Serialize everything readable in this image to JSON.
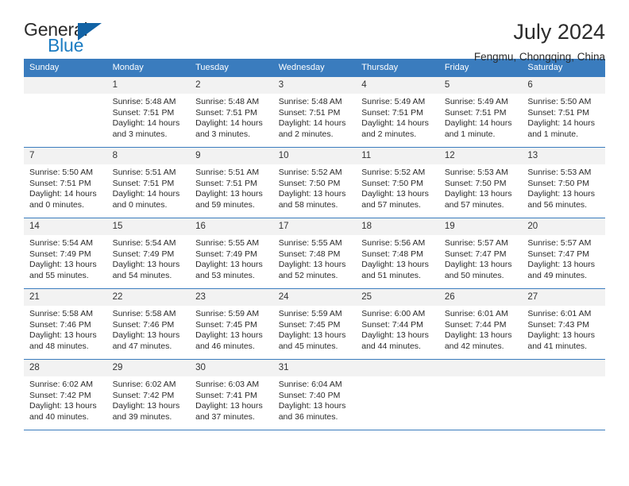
{
  "brand": {
    "name_top": "General",
    "name_bottom": "Blue",
    "triangle_icon": "blue-triangle-logo-mark",
    "color_top": "#2b2b2b",
    "color_bottom": "#1b7cc2",
    "accent": "#1263a5"
  },
  "header": {
    "title": "July 2024",
    "subtitle": "Fengmu, Chongqing, China"
  },
  "theme": {
    "header_bg": "#3a7cbe",
    "header_text": "#ffffff",
    "daynum_bg": "#f2f2f2",
    "grid_line": "#3a7cbe"
  },
  "weekdays": [
    "Sunday",
    "Monday",
    "Tuesday",
    "Wednesday",
    "Thursday",
    "Friday",
    "Saturday"
  ],
  "weeks": [
    [
      {
        "day": "",
        "sunrise": "",
        "sunset": "",
        "daylight_line1": "",
        "daylight_line2": ""
      },
      {
        "day": "1",
        "sunrise": "Sunrise: 5:48 AM",
        "sunset": "Sunset: 7:51 PM",
        "daylight_line1": "Daylight: 14 hours",
        "daylight_line2": "and 3 minutes."
      },
      {
        "day": "2",
        "sunrise": "Sunrise: 5:48 AM",
        "sunset": "Sunset: 7:51 PM",
        "daylight_line1": "Daylight: 14 hours",
        "daylight_line2": "and 3 minutes."
      },
      {
        "day": "3",
        "sunrise": "Sunrise: 5:48 AM",
        "sunset": "Sunset: 7:51 PM",
        "daylight_line1": "Daylight: 14 hours",
        "daylight_line2": "and 2 minutes."
      },
      {
        "day": "4",
        "sunrise": "Sunrise: 5:49 AM",
        "sunset": "Sunset: 7:51 PM",
        "daylight_line1": "Daylight: 14 hours",
        "daylight_line2": "and 2 minutes."
      },
      {
        "day": "5",
        "sunrise": "Sunrise: 5:49 AM",
        "sunset": "Sunset: 7:51 PM",
        "daylight_line1": "Daylight: 14 hours",
        "daylight_line2": "and 1 minute."
      },
      {
        "day": "6",
        "sunrise": "Sunrise: 5:50 AM",
        "sunset": "Sunset: 7:51 PM",
        "daylight_line1": "Daylight: 14 hours",
        "daylight_line2": "and 1 minute."
      }
    ],
    [
      {
        "day": "7",
        "sunrise": "Sunrise: 5:50 AM",
        "sunset": "Sunset: 7:51 PM",
        "daylight_line1": "Daylight: 14 hours",
        "daylight_line2": "and 0 minutes."
      },
      {
        "day": "8",
        "sunrise": "Sunrise: 5:51 AM",
        "sunset": "Sunset: 7:51 PM",
        "daylight_line1": "Daylight: 14 hours",
        "daylight_line2": "and 0 minutes."
      },
      {
        "day": "9",
        "sunrise": "Sunrise: 5:51 AM",
        "sunset": "Sunset: 7:51 PM",
        "daylight_line1": "Daylight: 13 hours",
        "daylight_line2": "and 59 minutes."
      },
      {
        "day": "10",
        "sunrise": "Sunrise: 5:52 AM",
        "sunset": "Sunset: 7:50 PM",
        "daylight_line1": "Daylight: 13 hours",
        "daylight_line2": "and 58 minutes."
      },
      {
        "day": "11",
        "sunrise": "Sunrise: 5:52 AM",
        "sunset": "Sunset: 7:50 PM",
        "daylight_line1": "Daylight: 13 hours",
        "daylight_line2": "and 57 minutes."
      },
      {
        "day": "12",
        "sunrise": "Sunrise: 5:53 AM",
        "sunset": "Sunset: 7:50 PM",
        "daylight_line1": "Daylight: 13 hours",
        "daylight_line2": "and 57 minutes."
      },
      {
        "day": "13",
        "sunrise": "Sunrise: 5:53 AM",
        "sunset": "Sunset: 7:50 PM",
        "daylight_line1": "Daylight: 13 hours",
        "daylight_line2": "and 56 minutes."
      }
    ],
    [
      {
        "day": "14",
        "sunrise": "Sunrise: 5:54 AM",
        "sunset": "Sunset: 7:49 PM",
        "daylight_line1": "Daylight: 13 hours",
        "daylight_line2": "and 55 minutes."
      },
      {
        "day": "15",
        "sunrise": "Sunrise: 5:54 AM",
        "sunset": "Sunset: 7:49 PM",
        "daylight_line1": "Daylight: 13 hours",
        "daylight_line2": "and 54 minutes."
      },
      {
        "day": "16",
        "sunrise": "Sunrise: 5:55 AM",
        "sunset": "Sunset: 7:49 PM",
        "daylight_line1": "Daylight: 13 hours",
        "daylight_line2": "and 53 minutes."
      },
      {
        "day": "17",
        "sunrise": "Sunrise: 5:55 AM",
        "sunset": "Sunset: 7:48 PM",
        "daylight_line1": "Daylight: 13 hours",
        "daylight_line2": "and 52 minutes."
      },
      {
        "day": "18",
        "sunrise": "Sunrise: 5:56 AM",
        "sunset": "Sunset: 7:48 PM",
        "daylight_line1": "Daylight: 13 hours",
        "daylight_line2": "and 51 minutes."
      },
      {
        "day": "19",
        "sunrise": "Sunrise: 5:57 AM",
        "sunset": "Sunset: 7:47 PM",
        "daylight_line1": "Daylight: 13 hours",
        "daylight_line2": "and 50 minutes."
      },
      {
        "day": "20",
        "sunrise": "Sunrise: 5:57 AM",
        "sunset": "Sunset: 7:47 PM",
        "daylight_line1": "Daylight: 13 hours",
        "daylight_line2": "and 49 minutes."
      }
    ],
    [
      {
        "day": "21",
        "sunrise": "Sunrise: 5:58 AM",
        "sunset": "Sunset: 7:46 PM",
        "daylight_line1": "Daylight: 13 hours",
        "daylight_line2": "and 48 minutes."
      },
      {
        "day": "22",
        "sunrise": "Sunrise: 5:58 AM",
        "sunset": "Sunset: 7:46 PM",
        "daylight_line1": "Daylight: 13 hours",
        "daylight_line2": "and 47 minutes."
      },
      {
        "day": "23",
        "sunrise": "Sunrise: 5:59 AM",
        "sunset": "Sunset: 7:45 PM",
        "daylight_line1": "Daylight: 13 hours",
        "daylight_line2": "and 46 minutes."
      },
      {
        "day": "24",
        "sunrise": "Sunrise: 5:59 AM",
        "sunset": "Sunset: 7:45 PM",
        "daylight_line1": "Daylight: 13 hours",
        "daylight_line2": "and 45 minutes."
      },
      {
        "day": "25",
        "sunrise": "Sunrise: 6:00 AM",
        "sunset": "Sunset: 7:44 PM",
        "daylight_line1": "Daylight: 13 hours",
        "daylight_line2": "and 44 minutes."
      },
      {
        "day": "26",
        "sunrise": "Sunrise: 6:01 AM",
        "sunset": "Sunset: 7:44 PM",
        "daylight_line1": "Daylight: 13 hours",
        "daylight_line2": "and 42 minutes."
      },
      {
        "day": "27",
        "sunrise": "Sunrise: 6:01 AM",
        "sunset": "Sunset: 7:43 PM",
        "daylight_line1": "Daylight: 13 hours",
        "daylight_line2": "and 41 minutes."
      }
    ],
    [
      {
        "day": "28",
        "sunrise": "Sunrise: 6:02 AM",
        "sunset": "Sunset: 7:42 PM",
        "daylight_line1": "Daylight: 13 hours",
        "daylight_line2": "and 40 minutes."
      },
      {
        "day": "29",
        "sunrise": "Sunrise: 6:02 AM",
        "sunset": "Sunset: 7:42 PM",
        "daylight_line1": "Daylight: 13 hours",
        "daylight_line2": "and 39 minutes."
      },
      {
        "day": "30",
        "sunrise": "Sunrise: 6:03 AM",
        "sunset": "Sunset: 7:41 PM",
        "daylight_line1": "Daylight: 13 hours",
        "daylight_line2": "and 37 minutes."
      },
      {
        "day": "31",
        "sunrise": "Sunrise: 6:04 AM",
        "sunset": "Sunset: 7:40 PM",
        "daylight_line1": "Daylight: 13 hours",
        "daylight_line2": "and 36 minutes."
      },
      {
        "day": "",
        "sunrise": "",
        "sunset": "",
        "daylight_line1": "",
        "daylight_line2": ""
      },
      {
        "day": "",
        "sunrise": "",
        "sunset": "",
        "daylight_line1": "",
        "daylight_line2": ""
      },
      {
        "day": "",
        "sunrise": "",
        "sunset": "",
        "daylight_line1": "",
        "daylight_line2": ""
      }
    ]
  ]
}
